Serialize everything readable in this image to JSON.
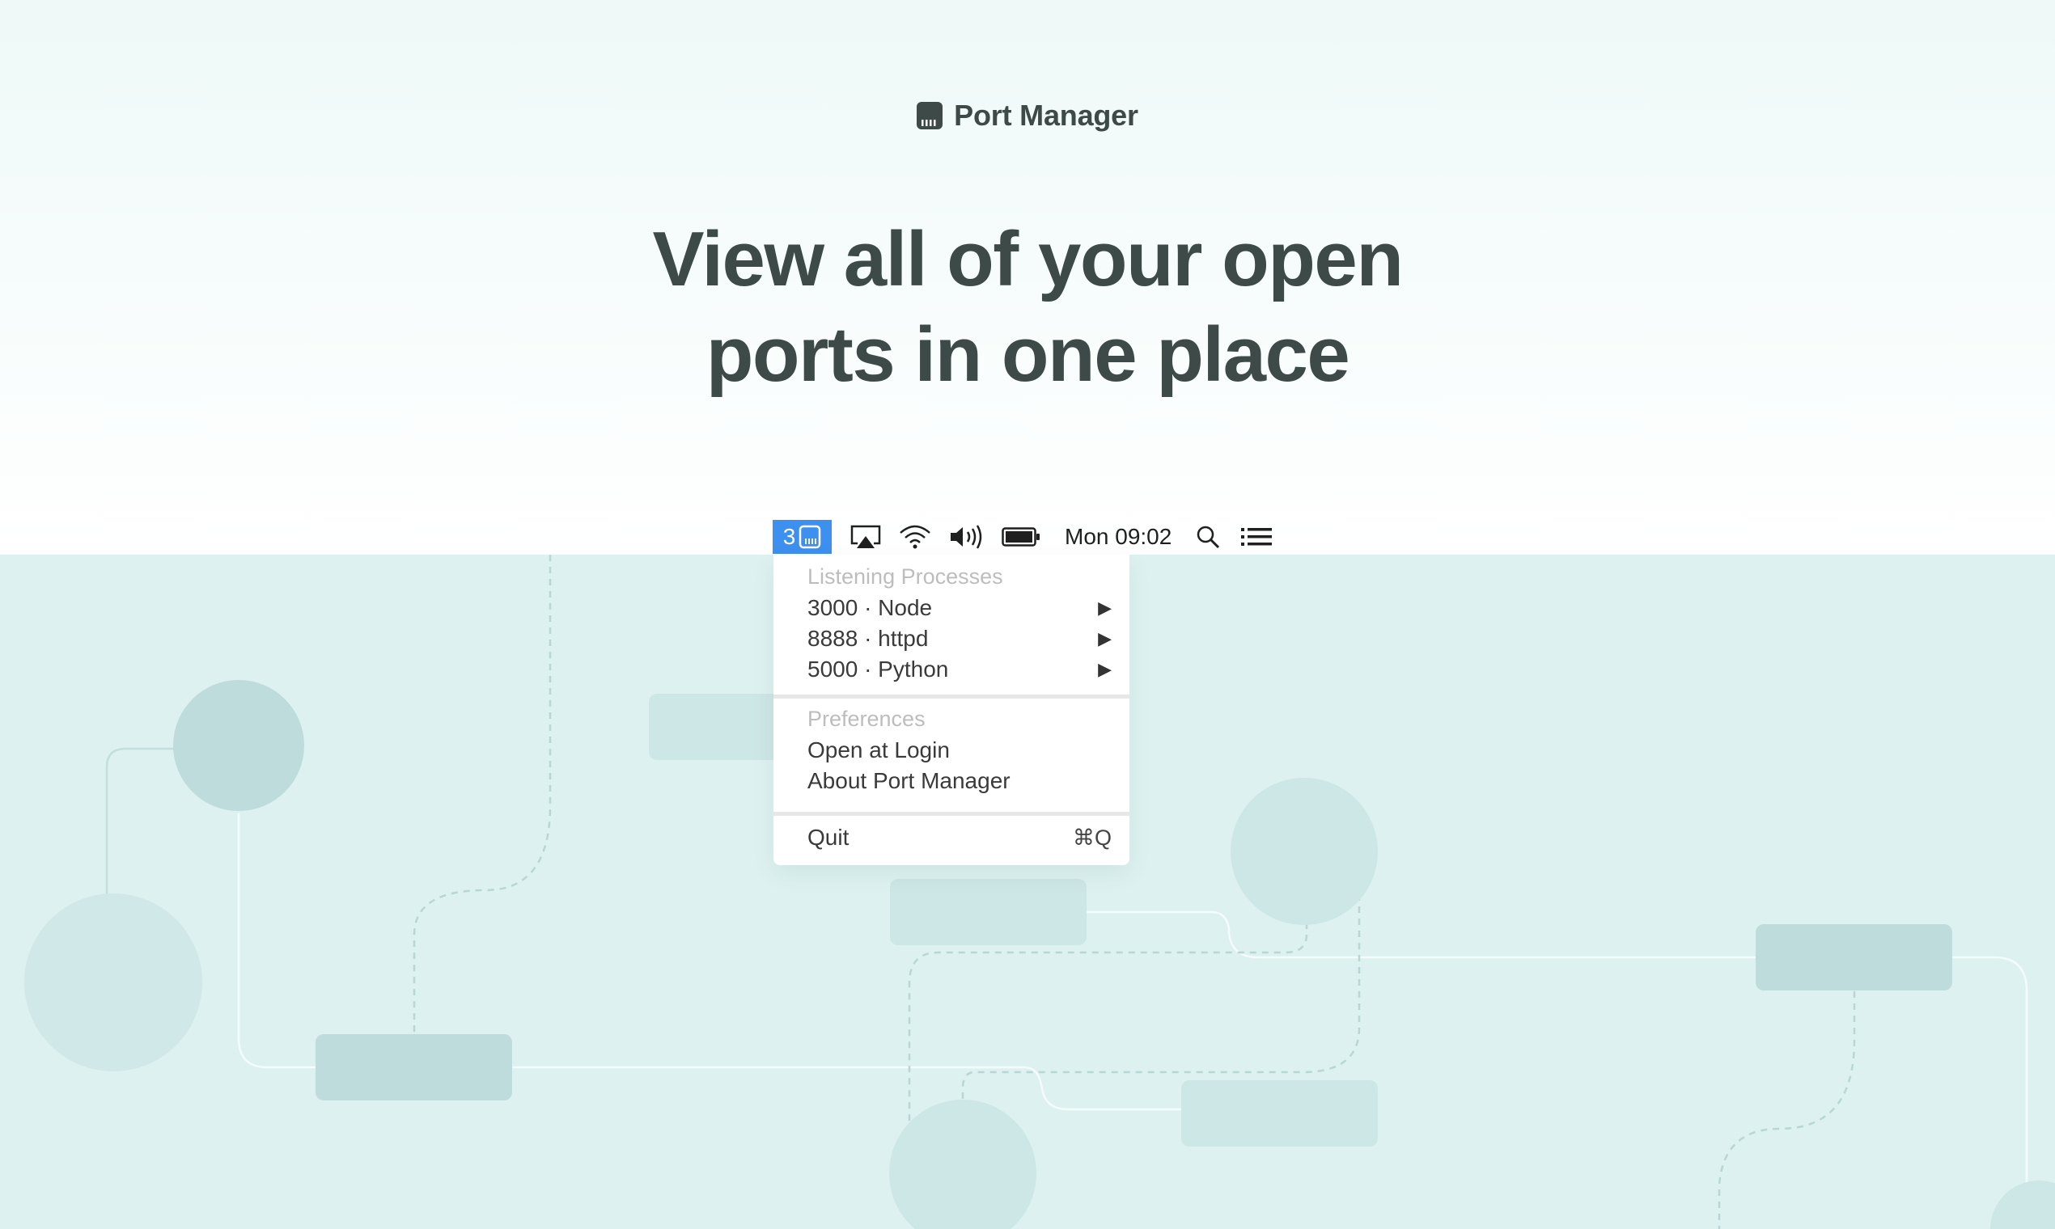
{
  "app": {
    "name": "Port Manager",
    "headline_line1": "View all of your open",
    "headline_line2": "ports in one place"
  },
  "menubar": {
    "status_count": "3",
    "clock": "Mon 09:02",
    "icons": [
      "port-icon",
      "airplay-icon",
      "wifi-icon",
      "volume-icon",
      "battery-icon",
      "search-icon",
      "list-icon"
    ],
    "accent_color": "#3d8ff0"
  },
  "menu": {
    "listening_title": "Listening Processes",
    "processes": [
      {
        "label": "3000 · Node"
      },
      {
        "label": "8888 · httpd"
      },
      {
        "label": "5000 · Python"
      }
    ],
    "preferences_title": "Preferences",
    "open_at_login": "Open at Login",
    "about": "About Port Manager",
    "quit": "Quit",
    "quit_shortcut": "⌘Q"
  },
  "colors": {
    "text_dark": "#3d4a48",
    "scene_bg": "#ddf1f0",
    "hero_bg": "#eef9f8"
  }
}
